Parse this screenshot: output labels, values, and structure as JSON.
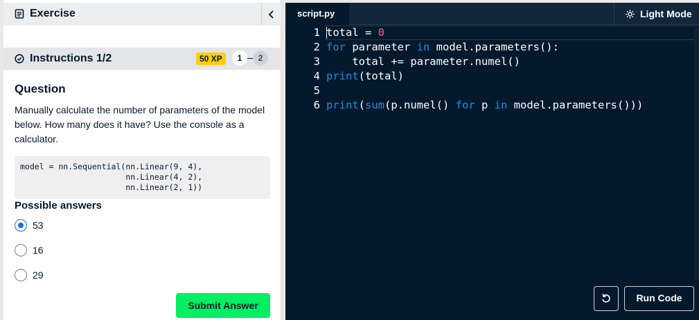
{
  "exercise_panel": {
    "header_title": "Exercise",
    "instructions_title": "Instructions 1/2",
    "xp_badge": "50 XP",
    "steps": [
      "1",
      "2"
    ],
    "question_title": "Question",
    "question_text": "Manually calculate the number of parameters of the model below. How many does it have? Use the console as a calculator.",
    "code_snippet": "model = nn.Sequential(nn.Linear(9, 4),\n                      nn.Linear(4, 2),\n                      nn.Linear(2, 1))",
    "answers_title": "Possible answers",
    "answers": [
      {
        "label": "53",
        "selected": true
      },
      {
        "label": "16",
        "selected": false
      },
      {
        "label": "29",
        "selected": false
      }
    ],
    "submit_label": "Submit Answer"
  },
  "editor": {
    "tab_label": "script.py",
    "mode_label": "Light Mode",
    "lines": [
      {
        "num": "1",
        "tokens": [
          {
            "t": "total = "
          },
          {
            "t": "0",
            "c": "num"
          }
        ]
      },
      {
        "num": "2",
        "tokens": [
          {
            "t": "for",
            "c": "kw"
          },
          {
            "t": " parameter "
          },
          {
            "t": "in",
            "c": "kw"
          },
          {
            "t": " model.parameters():"
          }
        ]
      },
      {
        "num": "3",
        "tokens": [
          {
            "t": "    total += parameter.numel()"
          }
        ]
      },
      {
        "num": "4",
        "tokens": [
          {
            "t": "print",
            "c": "kw"
          },
          {
            "t": "(total)"
          }
        ]
      },
      {
        "num": "5",
        "tokens": []
      },
      {
        "num": "6",
        "tokens": [
          {
            "t": "print",
            "c": "kw"
          },
          {
            "t": "("
          },
          {
            "t": "sum",
            "c": "kw"
          },
          {
            "t": "(p.numel() "
          },
          {
            "t": "for",
            "c": "kw"
          },
          {
            "t": " p "
          },
          {
            "t": "in",
            "c": "kw"
          },
          {
            "t": " model.parameters()))"
          }
        ]
      }
    ],
    "run_label": "Run Code"
  },
  "colors": {
    "accent_green": "#03ef62",
    "xp_yellow": "#fcce0d",
    "editor_bg": "#05192d",
    "keyword_blue": "#1f8de5",
    "number_pink": "#ff5c8a",
    "radio_blue": "#2268d4"
  },
  "icons": {
    "exercise": "document-icon",
    "instructions": "check-circle-icon",
    "collapse": "chevron-left-icon",
    "mode": "sun-icon",
    "reset": "reset-icon"
  }
}
